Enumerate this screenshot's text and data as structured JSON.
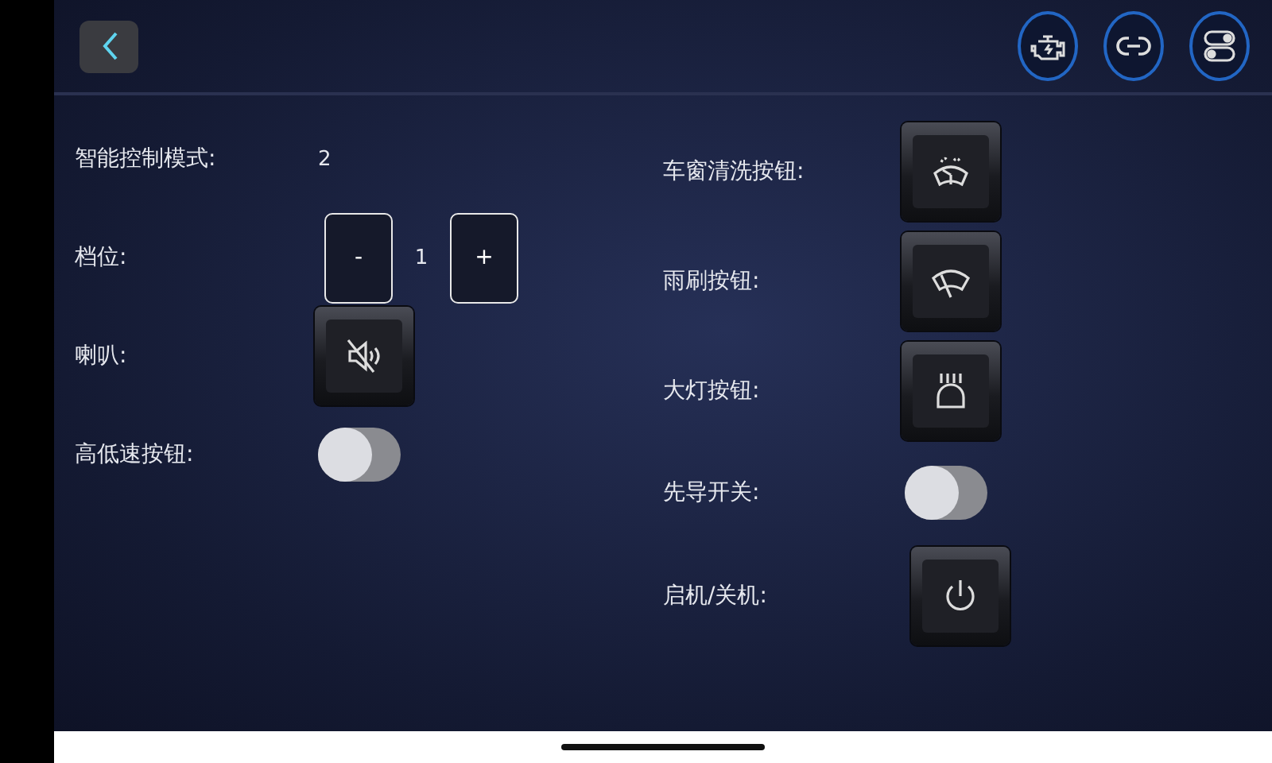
{
  "left_controls": [
    {
      "kind": "value",
      "label": "智能控制模式:",
      "value": "2"
    },
    {
      "kind": "stepper",
      "label": "档位:",
      "minus": "-",
      "value": "1",
      "plus": "+"
    },
    {
      "kind": "horn",
      "label": "喇叭:"
    },
    {
      "kind": "toggle",
      "label": "高低速按钮:",
      "on": false
    }
  ],
  "right_controls": [
    {
      "kind": "washer",
      "label": "车窗清洗按钮:"
    },
    {
      "kind": "wiper",
      "label": "雨刷按钮:"
    },
    {
      "kind": "headlight",
      "label": "大灯按钮:"
    },
    {
      "kind": "toggle",
      "label": "先导开关:",
      "on": false
    },
    {
      "kind": "power",
      "label": "启机/关机:"
    }
  ]
}
